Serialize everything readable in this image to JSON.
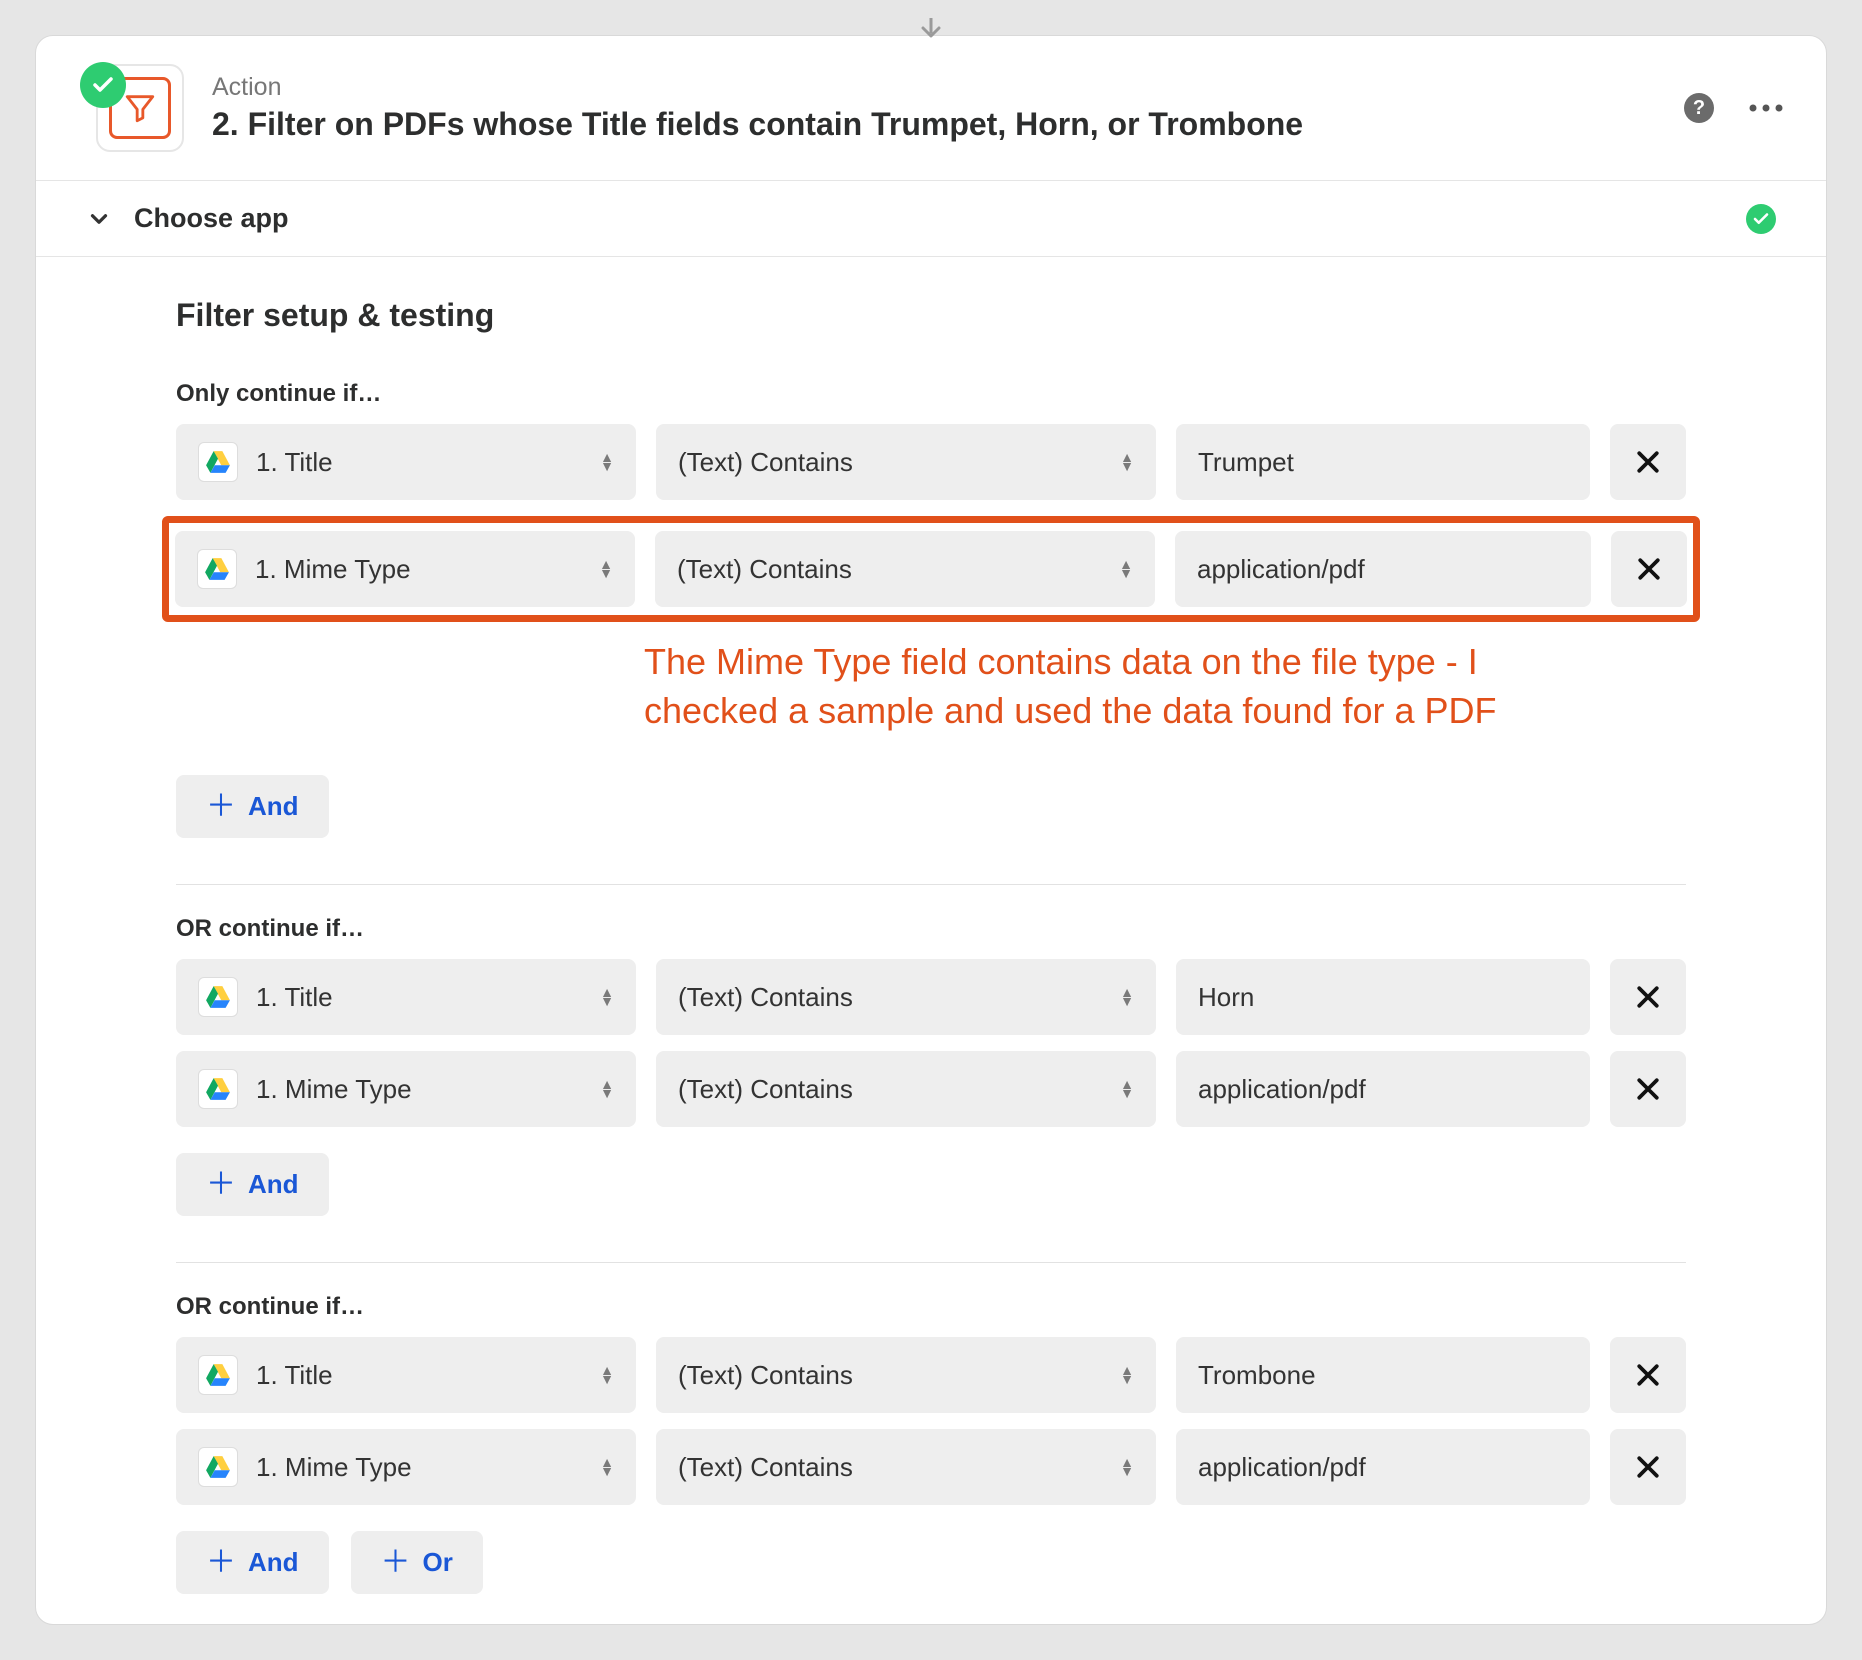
{
  "header": {
    "action_label": "Action",
    "title": "2. Filter on PDFs whose Title fields contain Trumpet, Horn, or Trombone"
  },
  "section": {
    "choose_app": "Choose app"
  },
  "setup": {
    "title": "Filter setup & testing",
    "only_label": "Only continue if…",
    "or_label": "OR continue if…",
    "and_btn": "And",
    "or_btn": "Or"
  },
  "annotation": "The Mime Type field contains data on the file type - I checked a sample and used the data found for a PDF",
  "groups": [
    {
      "label_key": "only_label",
      "rules": [
        {
          "field": "1. Title",
          "op": "(Text) Contains",
          "value": "Trumpet",
          "highlight": false
        },
        {
          "field": "1. Mime Type",
          "op": "(Text) Contains",
          "value": "application/pdf",
          "highlight": true
        }
      ],
      "show_annotation": true,
      "show_or_btn": false
    },
    {
      "label_key": "or_label",
      "rules": [
        {
          "field": "1. Title",
          "op": "(Text) Contains",
          "value": "Horn",
          "highlight": false
        },
        {
          "field": "1. Mime Type",
          "op": "(Text) Contains",
          "value": "application/pdf",
          "highlight": false
        }
      ],
      "show_annotation": false,
      "show_or_btn": false
    },
    {
      "label_key": "or_label",
      "rules": [
        {
          "field": "1. Title",
          "op": "(Text) Contains",
          "value": "Trombone",
          "highlight": false
        },
        {
          "field": "1. Mime Type",
          "op": "(Text) Contains",
          "value": "application/pdf",
          "highlight": false
        }
      ],
      "show_annotation": false,
      "show_or_btn": true
    }
  ]
}
